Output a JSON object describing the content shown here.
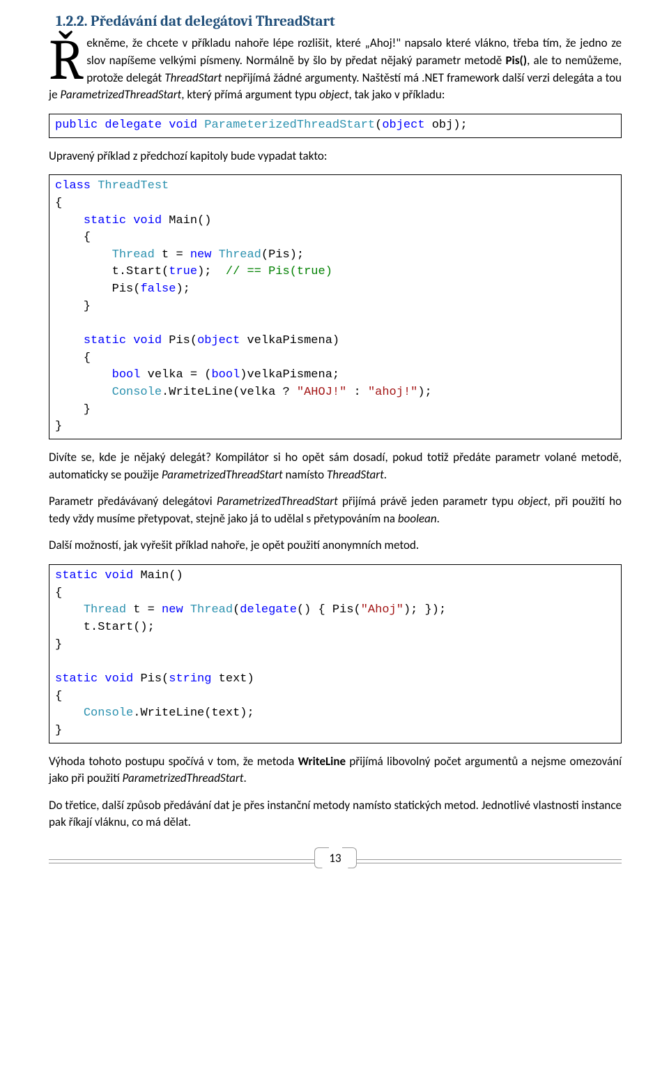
{
  "section": {
    "number": "1.2.2.",
    "title": "Předávání dat delegátovi ThreadStart"
  },
  "intro": {
    "dropcap": "Ř",
    "body": "ekněme, že chcete v příkladu nahoře lépe rozlišit, které „Ahoj!\" napsalo které vlákno, třeba tím, že jedno ze slov napíšeme velkými písmeny. Normálně by šlo by předat nějaký parametr metodě ",
    "bold1": "Pis()",
    "body2": ", ale to nemůžeme, protože delegát ",
    "ital1": "ThreadStart",
    "body3": " nepřijímá žádné argumenty. Naštěstí má .NET framework další verzi delegáta a tou je ",
    "ital2": "ParametrizedThreadStart",
    "body4": ", který přímá argument typu ",
    "ital3": "object",
    "body5": ", tak jako v příkladu:"
  },
  "code1": {
    "t": [
      "public",
      "delegate",
      "void",
      "ParameterizedThreadStart",
      "object",
      "obj"
    ]
  },
  "p2": "Upravený příklad z předchozí kapitoly bude vypadat takto:",
  "code2": {
    "class": "class",
    "ThreadTest": "ThreadTest",
    "static": "static",
    "void": "void",
    "Main": "Main",
    "Thread": "Thread",
    "t": "t",
    "new": "new",
    "Pis": "Pis",
    "Start": "Start",
    "true": "true",
    "cmt": "// == Pis(true)",
    "false": "false",
    "object": "object",
    "velkaPismena": "velkaPismena",
    "bool": "bool",
    "velka": "velka",
    "Console": "Console",
    "WriteLine": "WriteLine",
    "sAHOJ": "\"AHOJ!\"",
    "sahoj": "\"ahoj!\""
  },
  "p3": {
    "a": "Divíte se, kde je nějaký delegát? Kompilátor si ho opět sám dosadí, pokud totiž předáte parametr volané metodě, automaticky se použije ",
    "i1": "ParametrizedThreadStart",
    "b": " namísto ",
    "i2": "ThreadStart",
    "c": "."
  },
  "p4": {
    "a": "Parametr předávávaný delegátovi ",
    "i1": "ParametrizedThreadStart",
    "b": " přijímá právě jeden parametr typu ",
    "i2": "object",
    "c": ", při použití ho tedy vždy musíme přetypovat, stejně jako já to udělal s přetypováním na ",
    "i3": "boolean",
    "d": "."
  },
  "p5": "Další možností, jak vyřešit příklad nahoře, je opět použití anonymních metod.",
  "code3": {
    "static": "static",
    "void": "void",
    "Main": "Main",
    "Thread": "Thread",
    "t": "t",
    "new": "new",
    "delegate": "delegate",
    "Pis": "Pis",
    "sAhoj": "\"Ahoj\"",
    "Start": "Start",
    "string": "string",
    "text": "text",
    "Console": "Console",
    "WriteLine": "WriteLine"
  },
  "p6": {
    "a": "Výhoda tohoto postupu spočívá v tom, že metoda ",
    "b1": "WriteLine",
    "b": " přijímá libovolný počet argumentů a nejsme omezování jako při použití ",
    "i1": "ParametrizedThreadStart",
    "c": "."
  },
  "p7": "Do třetice, další způsob předávání dat je přes instanční metody namísto statických metod. Jednotlivé vlastnosti instance pak říkají vláknu, co má dělat.",
  "pageNumber": "13"
}
